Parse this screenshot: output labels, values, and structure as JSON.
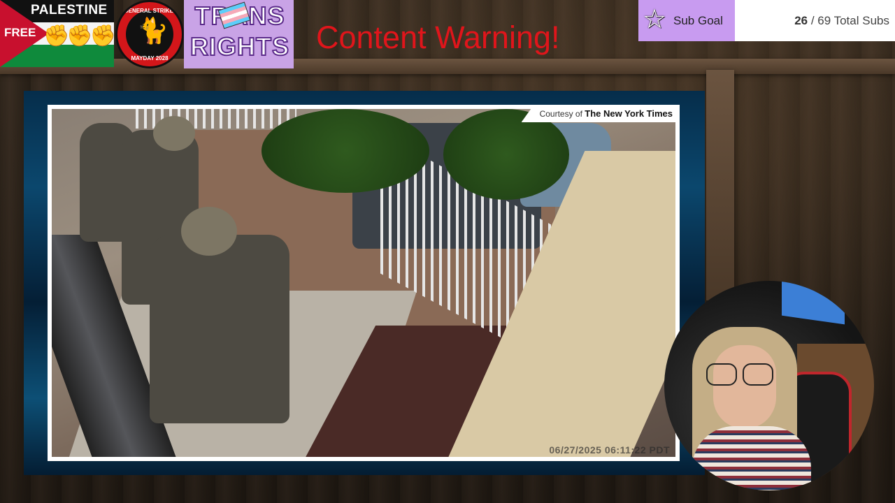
{
  "badges": {
    "palestine": {
      "line1": "PALESTINE",
      "line2": "FREE"
    },
    "strike": {
      "top": "GENERAL STRIKE!",
      "bottom": "MAYDAY 2028"
    },
    "trans": {
      "line1": "TRANS",
      "line2": "RIGHTS"
    }
  },
  "overlay": {
    "content_warning": "Content Warning!"
  },
  "sub_goal": {
    "label": "Sub Goal",
    "current": "26",
    "separator": " / ",
    "total_text": "69 Total Subs",
    "progress": 0.377,
    "accent_color": "#c89bf0"
  },
  "video": {
    "courtesy_prefix": "Courtesy of ",
    "courtesy_source": "The New York Times",
    "timestamp": "06/27/2025 06:11:22 PDT",
    "frame_color": "#1a88c6"
  },
  "icons": {
    "sub_goal_icon": "star-icon"
  }
}
